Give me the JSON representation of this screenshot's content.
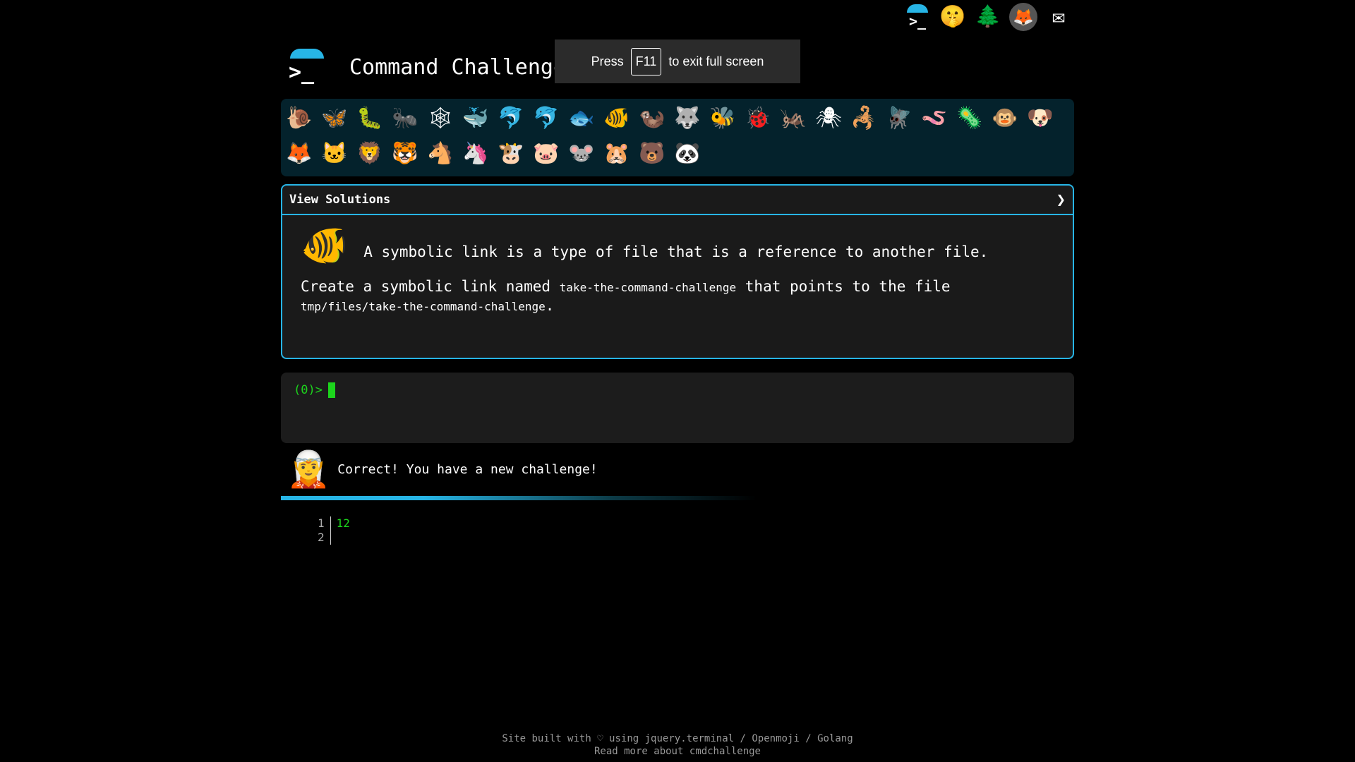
{
  "topbar": {
    "icons": [
      "terminal-logo-icon",
      "shushing-face-icon",
      "tree-icon",
      "gitlab-fox-icon",
      "envelope-icon"
    ],
    "terminal_prompt": ">_",
    "glyphs": {
      "shush": "🤫",
      "tree": "🌲",
      "fox": "🦊",
      "mail": "✉"
    }
  },
  "header": {
    "logo_prompt": ">_",
    "title": "Command Challenge"
  },
  "fullscreen_toast": {
    "press": "Press",
    "key": "F11",
    "rest": "to exit full screen"
  },
  "animals": [
    "🐌",
    "🦋",
    "🐛",
    "🐜",
    "🕸",
    "🐳",
    "🐬",
    "🐬",
    "🐟",
    "🐠",
    "🦦",
    "🐺",
    "🐝",
    "🐞",
    "🦗",
    "🕷",
    "🦂",
    "🪰",
    "🪱",
    "🦠",
    "🐵",
    "🐶",
    "🦊",
    "🐱",
    "🦁",
    "🐯",
    "🐴",
    "🦄",
    "🐮",
    "🐷",
    "🐭",
    "🐹",
    "🐻",
    "🐼"
  ],
  "challenge": {
    "header_label": "View Solutions",
    "chevron": "❯",
    "fish": "🐠",
    "lead": "A symbolic link is a type of file that is a reference to another file.",
    "create_prefix": "Create a symbolic link named",
    "link_name": "take-the-command-challenge",
    "create_mid": "that points to the file",
    "target_path": "tmp/files/take-the-command-challenge",
    "period": "."
  },
  "terminal": {
    "prompt": "(0)>"
  },
  "feedback": {
    "avatar": "🧝",
    "message": "Correct! You have a new challenge!"
  },
  "progress": 0.6,
  "code_lines": {
    "numbers": [
      "1",
      "2"
    ],
    "values": [
      "12",
      ""
    ]
  },
  "footer": {
    "line1": "Site built with ♡ using jquery.terminal / Openmoji / Golang",
    "line2": "Read more about cmdchallenge"
  }
}
